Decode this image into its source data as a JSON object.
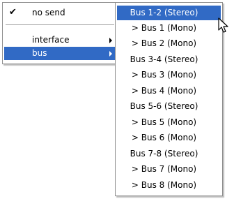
{
  "menu": {
    "items": [
      {
        "label": "no send",
        "checked": true,
        "has_submenu": false
      },
      {
        "label": "interface",
        "checked": false,
        "has_submenu": true
      },
      {
        "label": "bus",
        "checked": false,
        "has_submenu": true,
        "selected": true
      }
    ]
  },
  "submenu": {
    "items": [
      {
        "label": "Bus 1-2 (Stereo)",
        "selected": true
      },
      {
        "label": "> Bus 1 (Mono)"
      },
      {
        "label": "> Bus 2 (Mono)"
      },
      {
        "label": "Bus 3-4 (Stereo)"
      },
      {
        "label": "> Bus 3 (Mono)"
      },
      {
        "label": "> Bus 4 (Mono)"
      },
      {
        "label": "Bus 5-6 (Stereo)"
      },
      {
        "label": "> Bus 5 (Mono)"
      },
      {
        "label": "> Bus 6 (Mono)"
      },
      {
        "label": "Bus 7-8 (Stereo)"
      },
      {
        "label": "> Bus 7 (Mono)"
      },
      {
        "label": "> Bus 8 (Mono)"
      }
    ]
  },
  "icons": {
    "check": "checkmark-icon",
    "submenu_arrow": "submenu-arrow-icon",
    "cursor": "mouse-pointer-icon"
  },
  "colors": {
    "highlight": "#316ac5",
    "highlight_text": "#ffffff"
  }
}
